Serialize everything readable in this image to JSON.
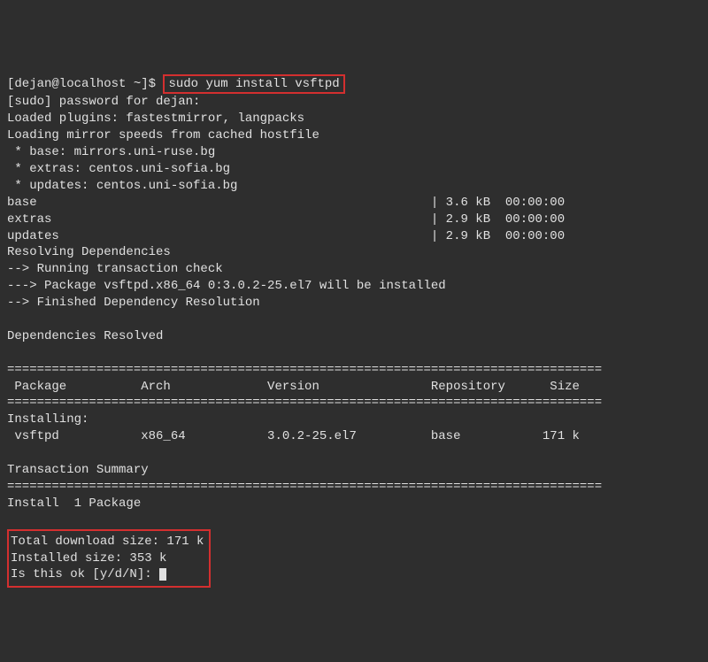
{
  "prompt": {
    "user_host": "[dejan@localhost ~]$",
    "command": "sudo yum install vsftpd"
  },
  "output": {
    "sudo_pw": "[sudo] password for dejan:",
    "plugins": "Loaded plugins: fastestmirror, langpacks",
    "loading": "Loading mirror speeds from cached hostfile",
    "mirror_base": " * base: mirrors.uni-ruse.bg",
    "mirror_extras": " * extras: centos.uni-sofia.bg",
    "mirror_updates": " * updates: centos.uni-sofia.bg",
    "repo_base": "base                                                     | 3.6 kB  00:00:00",
    "repo_extras": "extras                                                   | 2.9 kB  00:00:00",
    "repo_updates": "updates                                                  | 2.9 kB  00:00:00",
    "resolving": "Resolving Dependencies",
    "trans_check": "--> Running transaction check",
    "pkg_install": "---> Package vsftpd.x86_64 0:3.0.2-25.el7 will be installed",
    "finished": "--> Finished Dependency Resolution",
    "deps_resolved": "Dependencies Resolved",
    "hr": "================================================================================",
    "table_header": " Package          Arch             Version               Repository      Size",
    "installing_label": "Installing:",
    "pkg_row": " vsftpd           x86_64           3.0.2-25.el7          base           171 k",
    "trans_summary": "Transaction Summary",
    "install_count": "Install  1 Package",
    "download_size": "Total download size: 171 k",
    "installed_size": "Installed size: 353 k",
    "confirm": "Is this ok [y/d/N]: "
  }
}
